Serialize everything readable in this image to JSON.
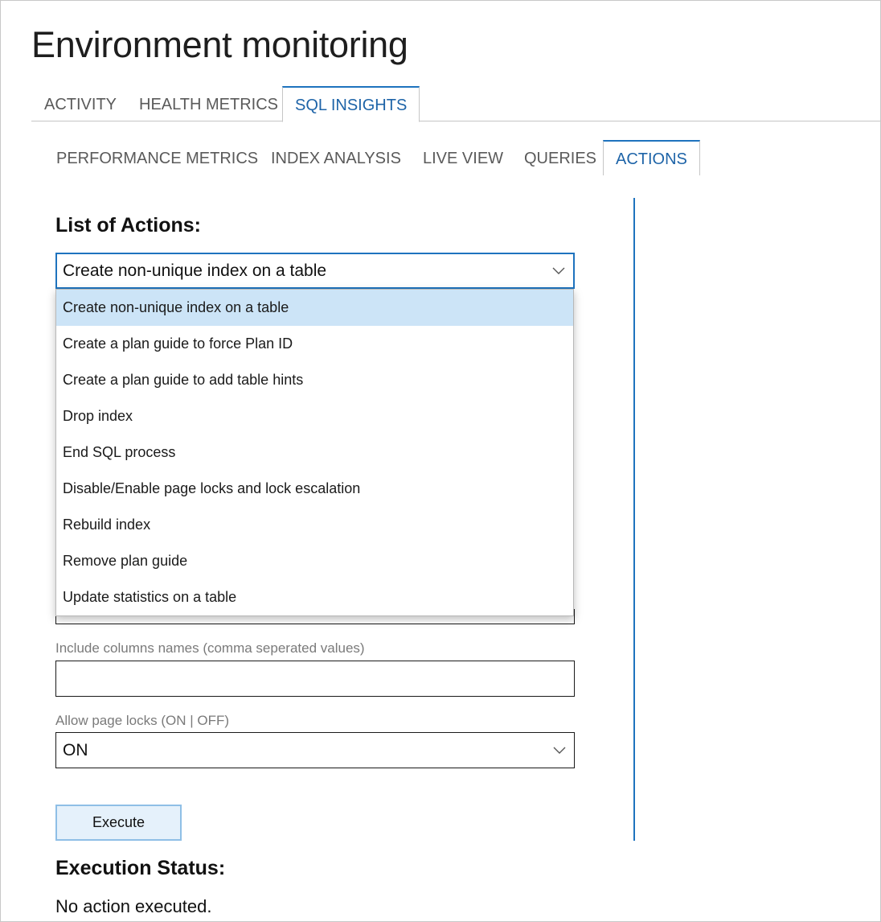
{
  "page": {
    "title": "Environment monitoring"
  },
  "primary_tabs": [
    {
      "label": "ACTIVITY",
      "active": false
    },
    {
      "label": "HEALTH METRICS",
      "active": false
    },
    {
      "label": "SQL INSIGHTS",
      "active": true
    }
  ],
  "secondary_tabs": [
    {
      "label": "PERFORMANCE METRICS",
      "active": false
    },
    {
      "label": "INDEX ANALYSIS",
      "active": false
    },
    {
      "label": "LIVE VIEW",
      "active": false
    },
    {
      "label": "QUERIES",
      "active": false
    },
    {
      "label": "ACTIONS",
      "active": true
    }
  ],
  "actions": {
    "heading": "List of Actions:",
    "selected": "Create non-unique index on a table",
    "options": [
      "Create non-unique index on a table",
      "Create a plan guide to force Plan ID",
      "Create a plan guide to add table hints",
      "Drop index",
      "End SQL process",
      "Disable/Enable page locks and lock escalation",
      "Rebuild index",
      "Remove plan guide",
      "Update statistics on a table"
    ]
  },
  "form": {
    "include_columns_label": "Include columns names (comma seperated values)",
    "include_columns_value": "",
    "allow_page_locks_label": "Allow page locks (ON | OFF)",
    "allow_page_locks_value": "ON",
    "execute_label": "Execute"
  },
  "status": {
    "heading": "Execution Status:",
    "text": "No action executed."
  },
  "colors": {
    "accent": "#1e73be",
    "dropdown_highlight": "#cce4f7",
    "button_bg": "#e5f1fb"
  },
  "icons": {
    "dropdown": "chevron-down-icon"
  }
}
